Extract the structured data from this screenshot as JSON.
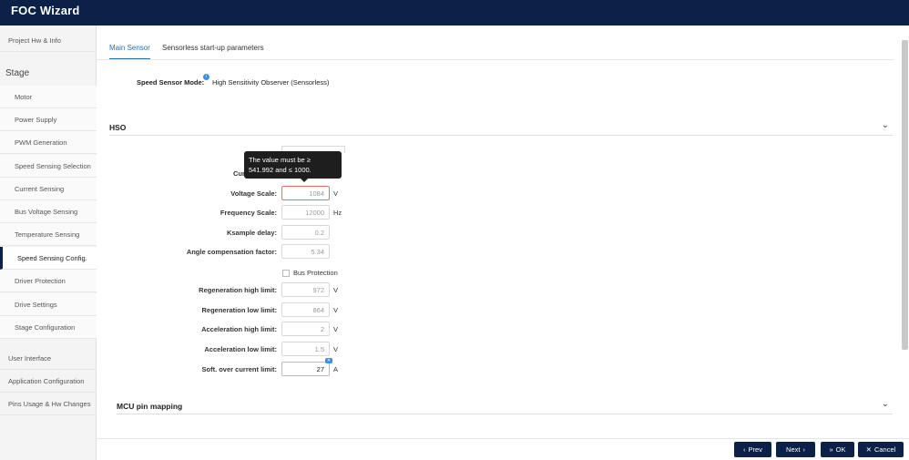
{
  "app": {
    "title": "FOC Wizard"
  },
  "sidebar": {
    "project": "Project Hw & Info",
    "stage_heading": "Stage",
    "stage_items": [
      "Motor",
      "Power Supply",
      "PWM Generation",
      "Speed Sensing Selection",
      "Current Sensing",
      "Bus Voltage Sensing",
      "Temperature Sensing",
      "Speed Sensing Config.",
      "Driver Protection",
      "Drive Settings",
      "Stage Configuration"
    ],
    "bottom_items": [
      "User Interface",
      "Application Configuration",
      "Pins Usage & Hw Changes"
    ]
  },
  "tabs": {
    "main_sensor": "Main Sensor",
    "sensorless": "Sensorless start-up parameters"
  },
  "speed_sensor": {
    "label": "Speed Sensor Mode:",
    "value": "High Sensitivity Observer (Sensorless)",
    "info_icon": "i"
  },
  "hso": {
    "title": "HSO",
    "partial_label": "Curr",
    "tooltip": "The value must be ≥ 541.992 and ≤ 1000.",
    "voltage_scale": {
      "label": "Voltage Scale:",
      "value": "1084",
      "unit": "V"
    },
    "frequency_scale": {
      "label": "Frequency Scale:",
      "value": "12000",
      "unit": "Hz"
    },
    "ksample_delay": {
      "label": "Ksample delay:",
      "value": "0.2"
    },
    "angle_comp": {
      "label": "Angle compensation factor:",
      "value": "5.34"
    },
    "bus_protection": "Bus Protection",
    "regen_high": {
      "label": "Regeneration high limit:",
      "value": "972",
      "unit": "V"
    },
    "regen_low": {
      "label": "Regeneration low limit:",
      "value": "864",
      "unit": "V"
    },
    "accel_high": {
      "label": "Acceleration high limit:",
      "value": "2",
      "unit": "V"
    },
    "accel_low": {
      "label": "Acceleration low limit:",
      "value": "1.5",
      "unit": "V"
    },
    "soft_oc": {
      "label": "Soft. over current limit:",
      "value": "27",
      "unit": "A"
    }
  },
  "mcu": {
    "title": "MCU pin mapping"
  },
  "footer": {
    "prev": "Prev",
    "next": "Next",
    "ok": "OK",
    "cancel": "Cancel"
  },
  "icons": {
    "chevron": "chevron-down-icon",
    "prev": "chevron-left-icon",
    "next": "chevron-right-icon",
    "ok": "double-chevron-icon",
    "cancel": "close-icon"
  }
}
